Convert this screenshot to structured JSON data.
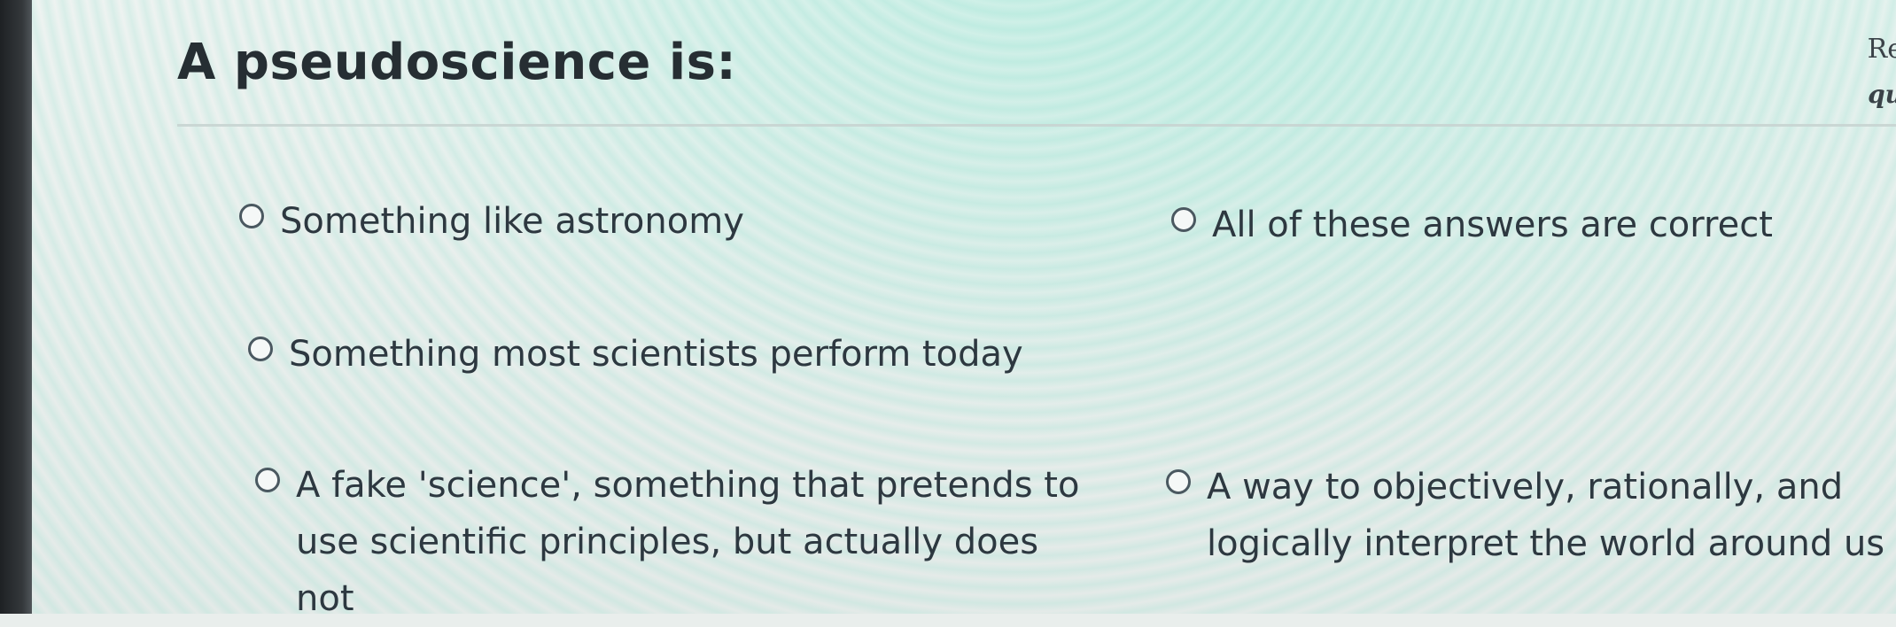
{
  "question": {
    "title": "A pseudoscience is:"
  },
  "side_panel": {
    "line1": "Re",
    "line2": "qu"
  },
  "answers": [
    {
      "label": "Something like astronomy"
    },
    {
      "label": "Something most scientists perform today"
    },
    {
      "label": "A fake 'science', something that pretends to use scientific principles, but actually does not"
    },
    {
      "label": "All of these answers are correct"
    },
    {
      "label": "A way to objectively, rationally, and logically interpret the world around us"
    }
  ]
}
